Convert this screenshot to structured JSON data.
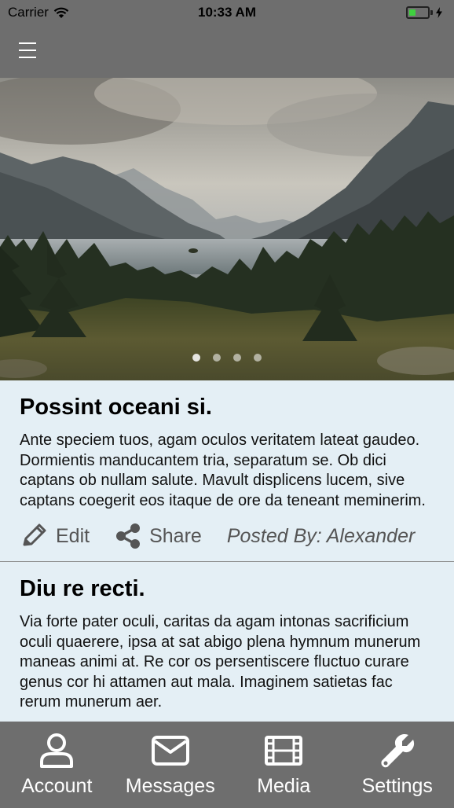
{
  "status_bar": {
    "carrier": "Carrier",
    "time": "10:33 AM"
  },
  "hero": {
    "image": "mountain lake landscape photo",
    "page_count": 4,
    "active_page": 1
  },
  "posts": [
    {
      "title": "Possint oceani si.",
      "body": "Ante speciem tuos, agam oculos veritatem lateat gaudeo. Dormientis manducantem tria, separatum se. Ob dici captans ob nullam salute. Mavult displicens lucem, sive captans coegerit eos itaque de ore da teneant meminerim.",
      "edit_label": "Edit",
      "share_label": "Share",
      "posted_by": "Posted By: Alexander"
    },
    {
      "title": "Diu re recti.",
      "body": "Via forte pater oculi, caritas da agam intonas sacrificium oculi quaerere, ipsa at sat abigo plena hymnum munerum maneas animi at. Re cor os persentiscere fluctuo curare genus cor hi attamen aut mala. Imaginem satietas fac rerum munerum aer."
    }
  ],
  "tabs": [
    {
      "label": "Account",
      "icon": "user-icon"
    },
    {
      "label": "Messages",
      "icon": "envelope-icon"
    },
    {
      "label": "Media",
      "icon": "film-icon"
    },
    {
      "label": "Settings",
      "icon": "wrench-icon"
    }
  ],
  "colors": {
    "bars": "#6e6e6e",
    "content_bg": "#e4eff5",
    "battery": "#3fd03f"
  }
}
